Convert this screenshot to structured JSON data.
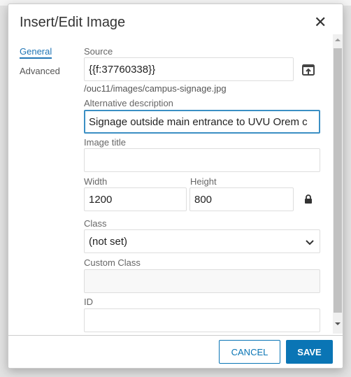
{
  "dialog": {
    "title": "Insert/Edit Image",
    "close_icon": "close-icon"
  },
  "tabs": [
    {
      "label": "General",
      "active": true
    },
    {
      "label": "Advanced",
      "active": false
    }
  ],
  "fields": {
    "source_label": "Source",
    "source_value": "{{f:37760338}}",
    "source_path": "/ouc11/images/campus-signage.jpg",
    "alt_label": "Alternative description",
    "alt_value": "Signage outside main entrance to UVU Orem c",
    "title_label": "Image title",
    "title_value": "",
    "width_label": "Width",
    "width_value": "1200",
    "height_label": "Height",
    "height_value": "800",
    "class_label": "Class",
    "class_value": "(not set)",
    "custom_class_label": "Custom Class",
    "custom_class_value": "",
    "id_label": "ID",
    "id_value": ""
  },
  "footer": {
    "cancel_label": "CANCEL",
    "save_label": "SAVE"
  },
  "colors": {
    "accent": "#0a75b5"
  }
}
